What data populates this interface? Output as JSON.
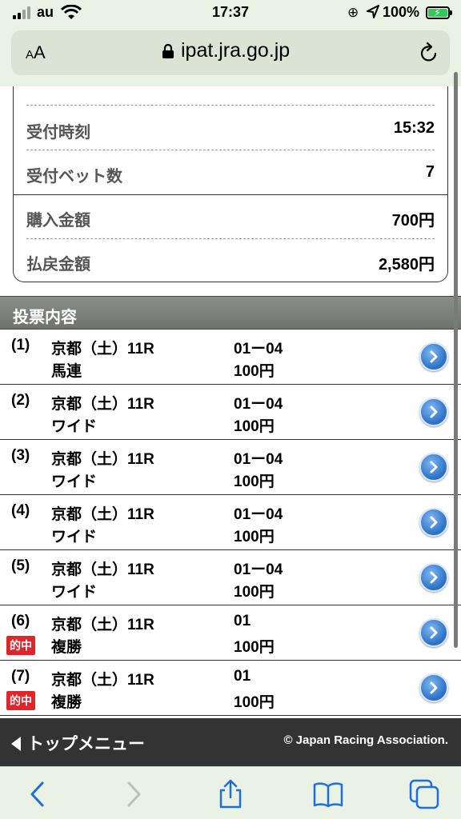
{
  "status_bar": {
    "carrier": "au",
    "time": "17:37",
    "battery": "100%",
    "battery_level": 1.0
  },
  "browser": {
    "aa_small": "A",
    "aa_large": "A",
    "url": "ipat.jra.go.jp"
  },
  "info": {
    "rows": [
      {
        "label": "受付時刻",
        "value": "15:32"
      },
      {
        "label": "受付ベット数",
        "value": "7"
      },
      {
        "label": "購入金額",
        "value": "700円"
      },
      {
        "label": "払戻金額",
        "value": "2,580円"
      }
    ]
  },
  "section": {
    "title": "投票内容"
  },
  "tickets": [
    {
      "num": "(1)",
      "race": "京都（土）11R",
      "type": "馬連",
      "combo": "01ー04",
      "amount": "100円",
      "hit": ""
    },
    {
      "num": "(2)",
      "race": "京都（土）11R",
      "type": "ワイド",
      "combo": "01ー04",
      "amount": "100円",
      "hit": ""
    },
    {
      "num": "(3)",
      "race": "京都（土）11R",
      "type": "ワイド",
      "combo": "01ー04",
      "amount": "100円",
      "hit": ""
    },
    {
      "num": "(4)",
      "race": "京都（土）11R",
      "type": "ワイド",
      "combo": "01ー04",
      "amount": "100円",
      "hit": ""
    },
    {
      "num": "(5)",
      "race": "京都（土）11R",
      "type": "ワイド",
      "combo": "01ー04",
      "amount": "100円",
      "hit": ""
    },
    {
      "num": "(6)",
      "race": "京都（土）11R",
      "type": "複勝",
      "combo": "01",
      "amount": "100円",
      "hit": "的中"
    },
    {
      "num": "(7)",
      "race": "京都（土）11R",
      "type": "複勝",
      "combo": "01",
      "amount": "100円",
      "hit": "的中"
    }
  ],
  "footer": {
    "back_label": "トップメニュー",
    "copyright": "© Japan Racing Association."
  },
  "colors": {
    "chrome_bg": "#e9f2e4",
    "hit_badge": "#e0262b",
    "section_header": "#7c817e",
    "footer_bg": "#333333",
    "link_blue": "#1b6fe0"
  },
  "icons": [
    "signal-icon",
    "wifi-icon",
    "rotation-lock-icon",
    "location-icon",
    "battery-icon",
    "lock-icon",
    "reload-icon",
    "chevron-right-circle-icon",
    "back-icon",
    "forward-icon",
    "share-icon",
    "bookmarks-icon",
    "tabs-icon"
  ]
}
